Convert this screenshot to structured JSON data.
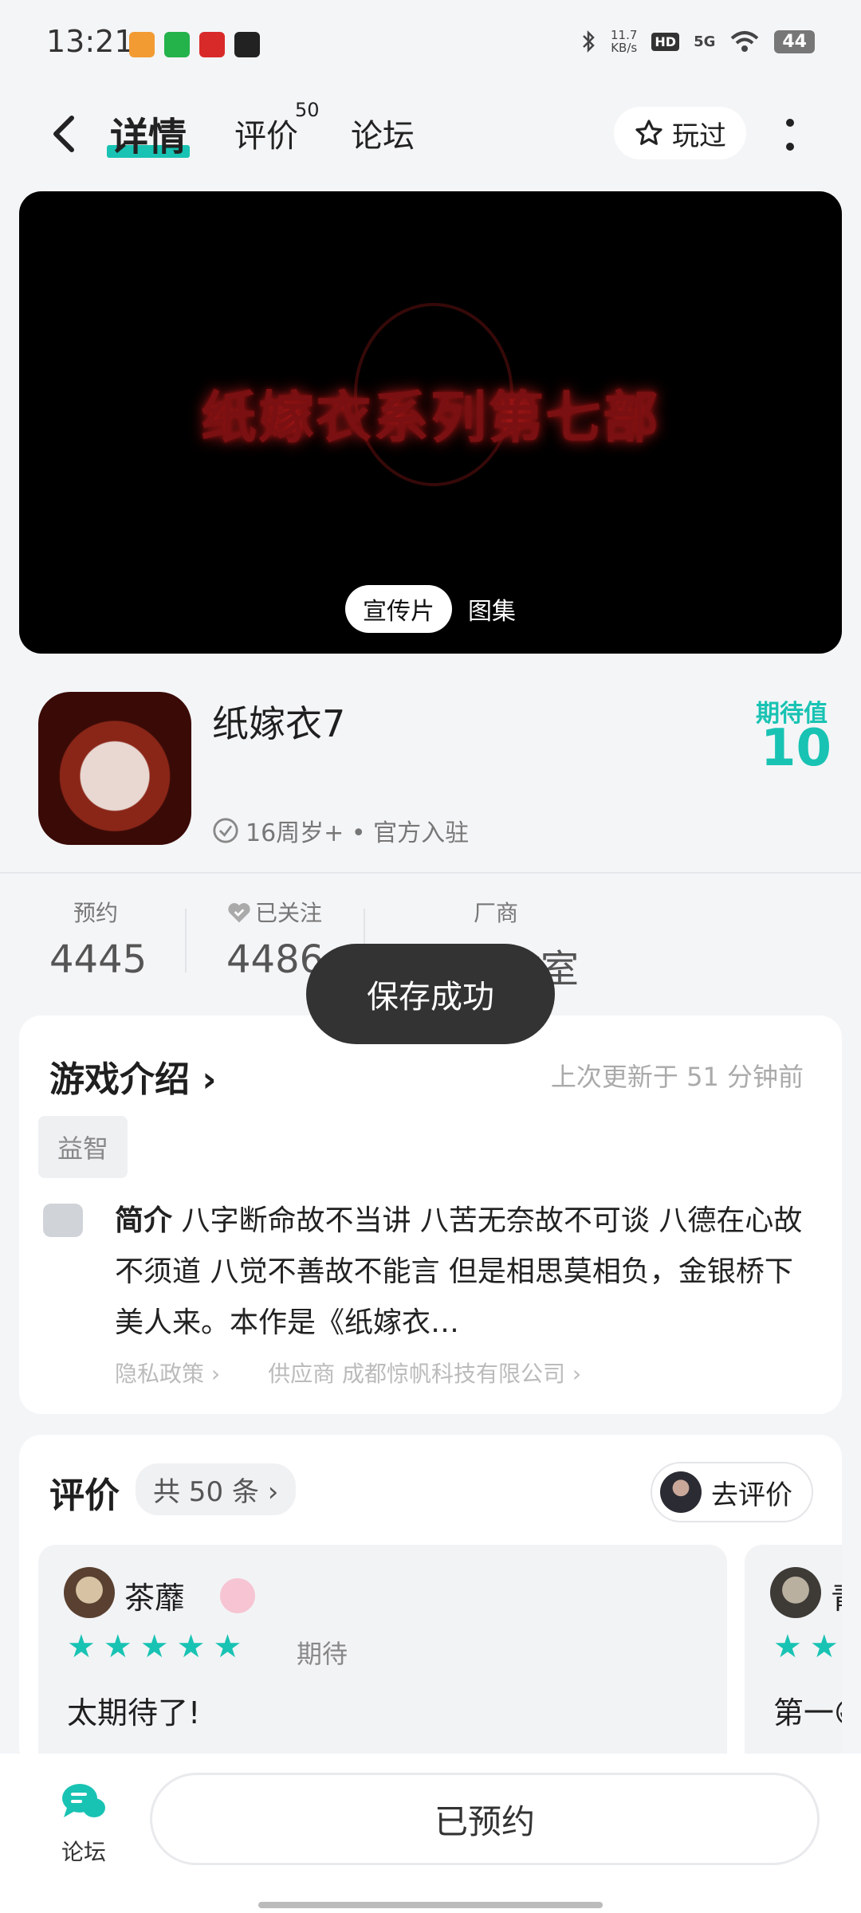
{
  "status_bar": {
    "time": "13:21",
    "net_speed": "11.7",
    "net_unit": "KB/s",
    "hd": "HD",
    "signal": "5G",
    "battery": "44",
    "app_colors": [
      "#f29b33",
      "#24b24b",
      "#d92a2a",
      "#222222"
    ]
  },
  "nav": {
    "tabs": [
      {
        "label": "详情",
        "active": true
      },
      {
        "label": "评价",
        "badge": "50"
      },
      {
        "label": "论坛"
      }
    ],
    "played_label": "玩过",
    "accent": "#19c3b3"
  },
  "video": {
    "title_text": "纸嫁衣系列第七部",
    "tabs": [
      "宣传片",
      "图集"
    ]
  },
  "game": {
    "name": "纸嫁衣7",
    "meta": "16周岁+ • 官方入驻",
    "expect_label": "期待值",
    "expect_value": "10"
  },
  "stats": [
    {
      "label": "预约",
      "value": "4445"
    },
    {
      "label": "已关注",
      "value": "4486"
    },
    {
      "label": "厂商",
      "value": "作室"
    }
  ],
  "toast": "保存成功",
  "intro": {
    "title": "游戏介绍",
    "updated": "上次更新于 51 分钟前",
    "tag": "益智",
    "lead": "简介",
    "text": "八字断命故不当讲 八苦无奈故不可谈 八德在心故不须道 八觉不善故不能言 但是相思莫相负，金银桥下美人来。本作是《纸嫁衣…",
    "privacy": "隐私政策",
    "supplier": "供应商 成都惊帆科技有限公司"
  },
  "reviews": {
    "title": "评价",
    "count": "共 50 条",
    "go_review": "去评价",
    "items": [
      {
        "name": "茶蘼",
        "level": "期待",
        "text": "太期待了!"
      },
      {
        "name": "青",
        "text": "第一😁"
      }
    ]
  },
  "bottom": {
    "forum_label": "论坛",
    "reserved_label": "已预约"
  }
}
